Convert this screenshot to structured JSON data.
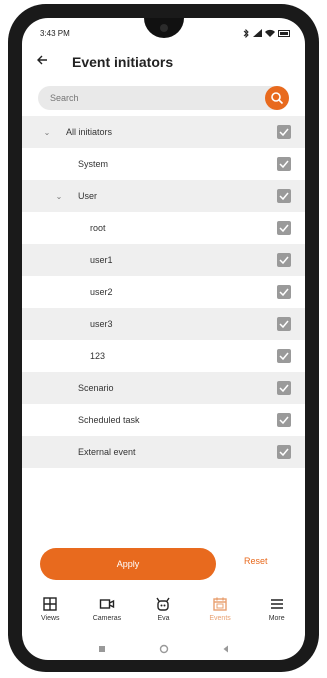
{
  "status_bar": {
    "time": "3:43 PM",
    "right_icons": [
      "bluetooth-icon",
      "signal-icon",
      "wifi-icon",
      "battery-icon"
    ]
  },
  "header": {
    "title": "Event initiators",
    "back_icon": "arrow-left-icon"
  },
  "search": {
    "placeholder": "Search",
    "button_icon": "search-icon"
  },
  "initiators": [
    {
      "label": "All initiators",
      "level": 0,
      "expandable": true,
      "expanded": true,
      "checked": true
    },
    {
      "label": "System",
      "level": 1,
      "expandable": false,
      "checked": true
    },
    {
      "label": "User",
      "level": 1,
      "expandable": true,
      "expanded": true,
      "checked": true
    },
    {
      "label": "root",
      "level": 2,
      "expandable": false,
      "checked": true
    },
    {
      "label": "user1",
      "level": 2,
      "expandable": false,
      "checked": true
    },
    {
      "label": "user2",
      "level": 2,
      "expandable": false,
      "checked": true
    },
    {
      "label": "user3",
      "level": 2,
      "expandable": false,
      "checked": true
    },
    {
      "label": "123",
      "level": 2,
      "expandable": false,
      "checked": true
    },
    {
      "label": "Scenario",
      "level": 1,
      "expandable": false,
      "checked": true
    },
    {
      "label": "Scheduled task",
      "level": 1,
      "expandable": false,
      "checked": true
    },
    {
      "label": "External event",
      "level": 1,
      "expandable": false,
      "checked": true
    }
  ],
  "actions": {
    "apply_label": "Apply",
    "reset_label": "Reset"
  },
  "tab_bar": {
    "active": "Events",
    "tabs": [
      {
        "label": "Views",
        "icon": "grid-icon"
      },
      {
        "label": "Cameras",
        "icon": "camera-icon"
      },
      {
        "label": "Eva",
        "icon": "robot-icon"
      },
      {
        "label": "Events",
        "icon": "calendar-icon"
      },
      {
        "label": "More",
        "icon": "menu-icon"
      }
    ]
  },
  "colors": {
    "accent": "#e86a1e",
    "accent_light": "#e8a070",
    "row_shade": "#efefef",
    "checkbox": "#9a9a9a",
    "search_bg": "#e9e9e9"
  }
}
